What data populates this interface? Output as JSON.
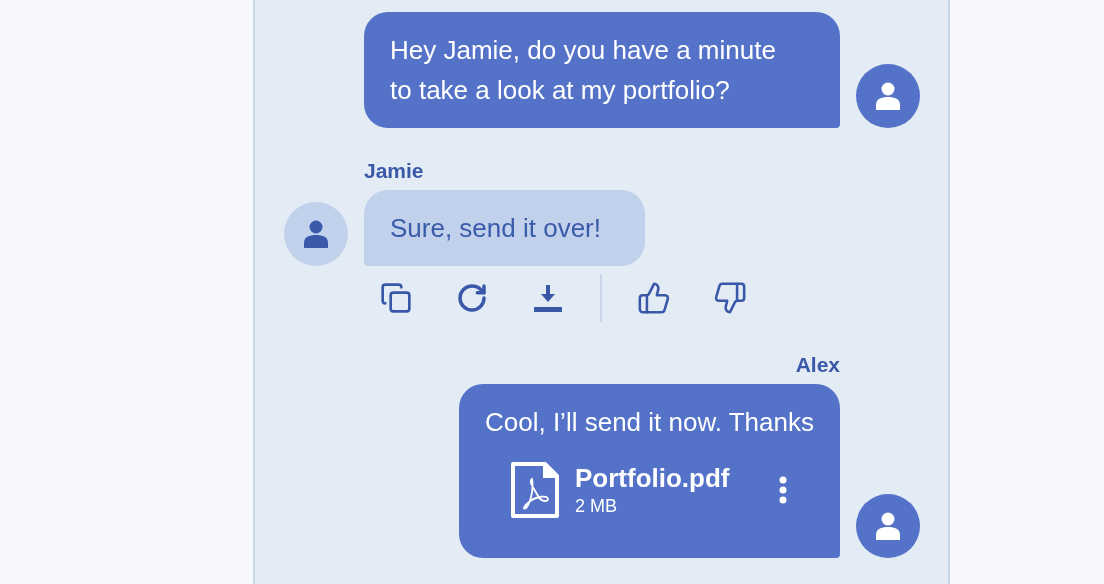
{
  "messages": [
    {
      "kind": "outgoing",
      "text": "Hey Jamie, do you have a minute to take a look at my portfolio?"
    },
    {
      "kind": "incoming",
      "sender": "Jamie",
      "text": "Sure, send it over!",
      "actions": [
        {
          "kind": "copy"
        },
        {
          "kind": "regenerate"
        },
        {
          "kind": "download"
        },
        {
          "kind": "divider"
        },
        {
          "kind": "like"
        },
        {
          "kind": "dislike"
        }
      ]
    },
    {
      "kind": "outgoing",
      "sender": "Alex",
      "text": "Cool, I’ll send it now. Thanks",
      "attachment": {
        "kind": "pdf",
        "name": "Portfolio.pdf",
        "size": "2 MB"
      }
    }
  ]
}
